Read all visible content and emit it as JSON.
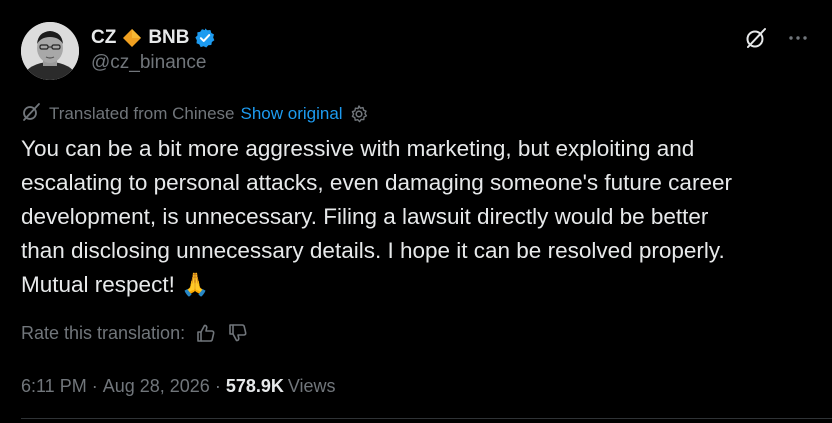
{
  "author": {
    "display_name_prefix": "CZ",
    "display_name_suffix": "BNB",
    "handle": "@cz_binance",
    "verified": true
  },
  "icons": {
    "avatar": "avatar-photo",
    "diamond": "orange-diamond-icon",
    "verified": "verified-badge-icon",
    "grok": "grok-icon",
    "more": "more-icon",
    "translate": "translate-icon",
    "gear": "gear-icon",
    "thumbs_up": "thumbs-up-icon",
    "thumbs_down": "thumbs-down-icon"
  },
  "translation": {
    "label": "Translated from Chinese",
    "show_original": "Show original"
  },
  "tweet": {
    "lines": [
      "You can be a bit more aggressive with marketing, but exploiting and",
      "escalating to personal attacks, even damaging someone's future career",
      "development, is unnecessary. Filing a lawsuit directly would be better",
      "than disclosing unnecessary details. I hope it can be resolved properly.",
      "Mutual respect! 🙏"
    ]
  },
  "rate": {
    "label": "Rate this translation:"
  },
  "meta": {
    "time": "6:11 PM",
    "separator": "·",
    "date": "Aug 28, 2026",
    "views_count": "578.9K",
    "views_label": "Views"
  },
  "colors": {
    "background": "#000000",
    "text_primary": "#e7e9ea",
    "text_muted": "#71767b",
    "link": "#1d9bf0",
    "verified": "#1d9bf0",
    "diamond": "#f0a020"
  }
}
